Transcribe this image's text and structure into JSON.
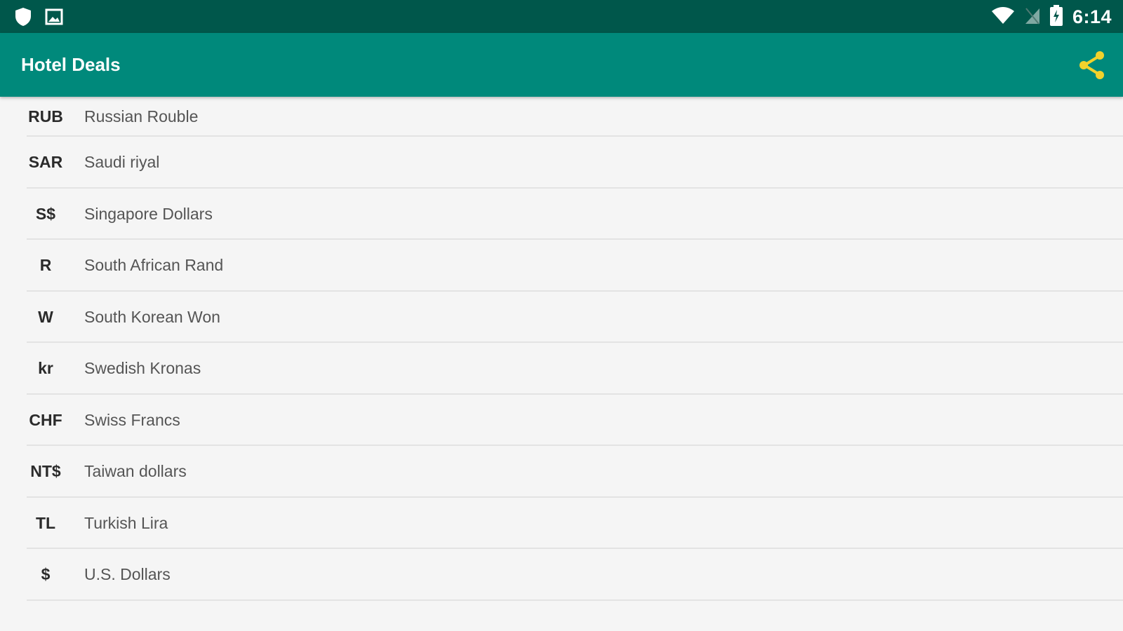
{
  "status_bar": {
    "time": "6:14",
    "icons": [
      "shield-icon",
      "image-icon",
      "wifi-icon",
      "no-sim-icon",
      "battery-charging-icon"
    ]
  },
  "app_bar": {
    "title": "Hotel Deals",
    "share_icon": "share-icon",
    "share_color": "#f2d22c"
  },
  "colors": {
    "status_bar": "#00574b",
    "app_bar": "#00897b",
    "background": "#f5f5f5"
  },
  "currencies": [
    {
      "code": "RUB",
      "name": "Russian Rouble"
    },
    {
      "code": "SAR",
      "name": "Saudi riyal"
    },
    {
      "code": "S$",
      "name": "Singapore Dollars"
    },
    {
      "code": "R",
      "name": "South African Rand"
    },
    {
      "code": "W",
      "name": "South Korean Won"
    },
    {
      "code": "kr",
      "name": "Swedish Kronas"
    },
    {
      "code": "CHF",
      "name": "Swiss Francs"
    },
    {
      "code": "NT$",
      "name": "Taiwan dollars"
    },
    {
      "code": "TL",
      "name": "Turkish Lira"
    },
    {
      "code": "$",
      "name": "U.S. Dollars"
    }
  ]
}
